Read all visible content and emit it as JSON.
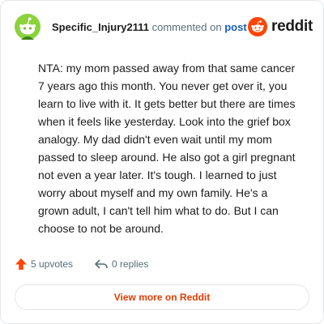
{
  "header": {
    "author": "Specific_Injury2111",
    "action_text": "commented on",
    "post_link": "post",
    "brand_name": "reddit"
  },
  "comment": {
    "body": "NTA: my mom passed away from that same cancer 7 years ago this month. You never get over it, you learn to live with it. It gets better but there are times when it feels like yesterday. Look into the grief box analogy. My dad didn't even wait until my mom passed to sleep around. He also got a girl pregnant not even a year later. It's tough. I learned to just worry about myself and my own family. He's a grown adult, I can't tell him what to do. But I can choose to not be around."
  },
  "footer": {
    "upvotes": "5 upvotes",
    "replies": "0 replies"
  },
  "cta": {
    "label": "View more on Reddit"
  },
  "colors": {
    "brand_orange": "#ff4500",
    "link_blue": "#1a5fb4",
    "cta_text": "#e23d00",
    "avatar_green": "#8bd23b"
  },
  "icons": [
    "snoo-avatar-icon",
    "reddit-logo-icon",
    "upvote-arrow-icon",
    "reply-arrow-icon"
  ]
}
